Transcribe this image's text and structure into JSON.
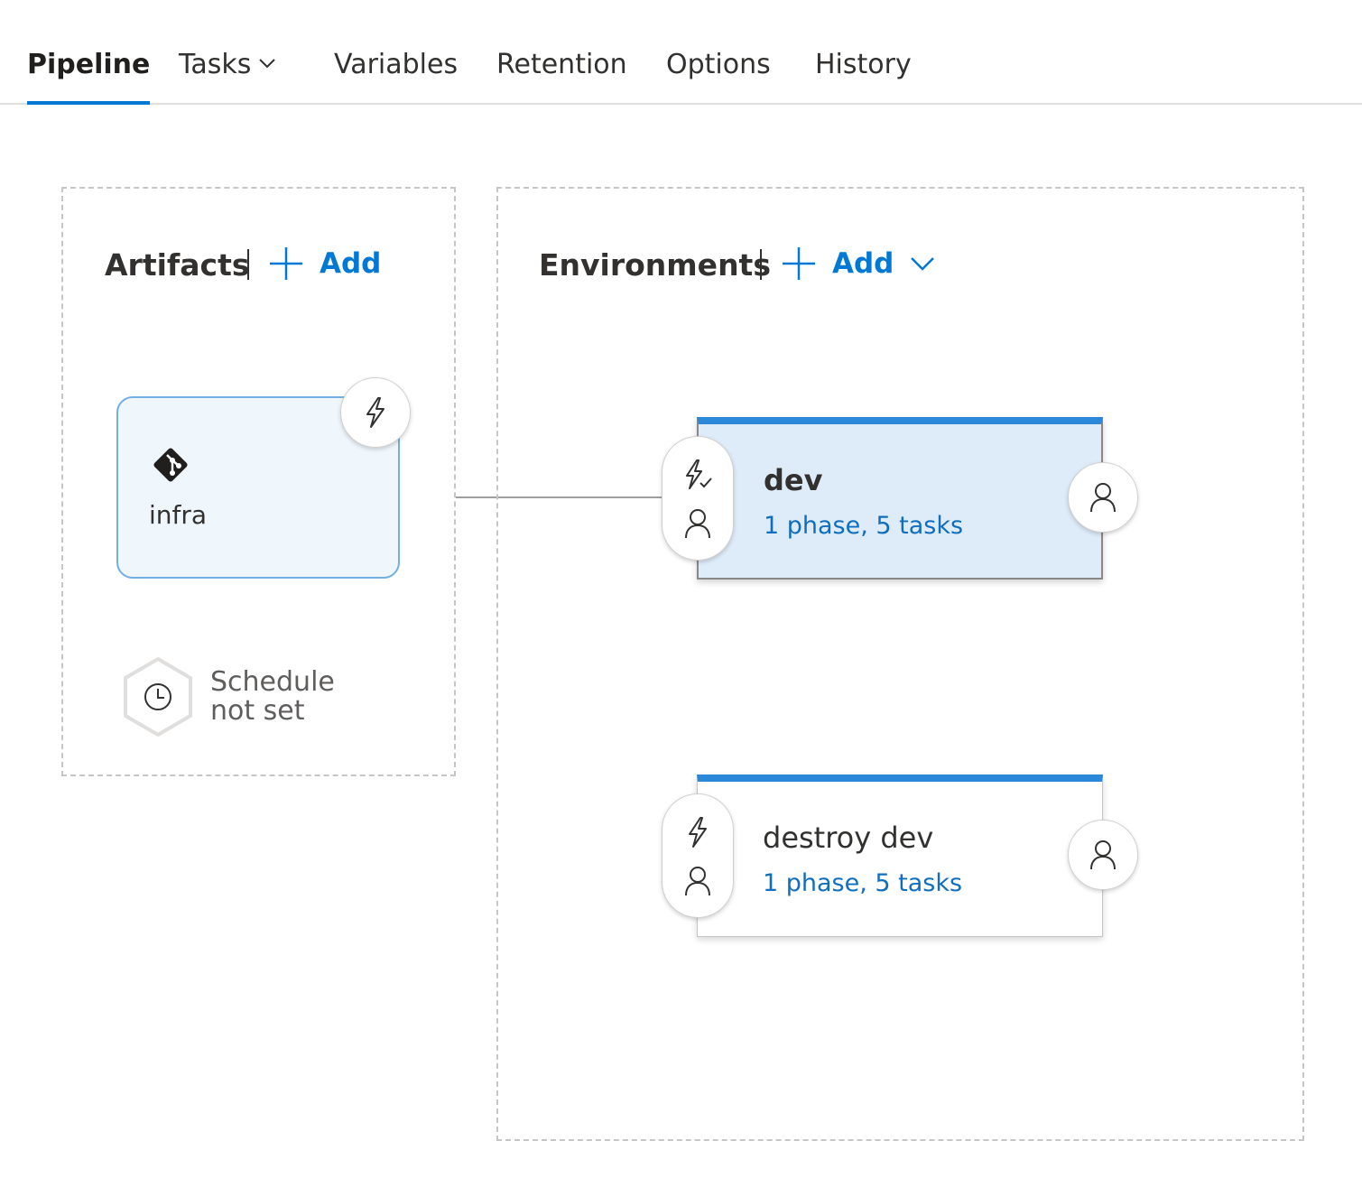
{
  "tabs": [
    {
      "label": "Pipeline",
      "active": true
    },
    {
      "label": "Tasks",
      "has_dropdown": true
    },
    {
      "label": "Variables"
    },
    {
      "label": "Retention"
    },
    {
      "label": "Options"
    },
    {
      "label": "History"
    }
  ],
  "artifacts": {
    "title": "Artifacts",
    "add_label": "Add",
    "items": [
      {
        "name": "infra",
        "icon": "git-icon",
        "trigger_icon": "lightning-icon"
      }
    ],
    "schedule": {
      "line1": "Schedule",
      "line2": "not set",
      "icon": "clock-icon"
    }
  },
  "environments": {
    "title": "Environments",
    "add_label": "Add",
    "items": [
      {
        "name": "dev",
        "summary": "1 phase, 5 tasks",
        "selected": true,
        "trigger_icon": "lightning-check-icon",
        "approver_icon": "person-icon"
      },
      {
        "name": "destroy dev",
        "summary": "1 phase, 5 tasks",
        "selected": false,
        "trigger_icon": "lightning-icon",
        "approver_icon": "person-icon"
      }
    ]
  },
  "colors": {
    "accent": "#0078d4",
    "env_top_bar": "#2b88d8",
    "selected_bg": "#deecf9",
    "artifact_bg": "#eff6fc",
    "link": "#106ebe"
  }
}
